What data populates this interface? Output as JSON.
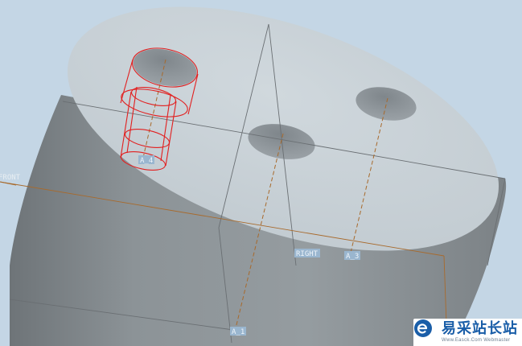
{
  "viewport": {
    "background": "#c4d6e5",
    "body_color": "#8e9599",
    "top_face_color": "#c9d1d6",
    "hole_color": "#8b9297",
    "datum_line_color": "#a86a2c",
    "hidden_edge_color": "#e21f1f",
    "label_color": "#9ab6cf"
  },
  "datum_planes": {
    "front_label": "FRONT",
    "right_label": "RIGHT"
  },
  "datum_axes": {
    "a1_label": "A_1",
    "a3_label": "A_3",
    "a4_label": "A_4"
  },
  "watermark": {
    "logo_icon": "e-letter-logo-icon",
    "logo_color": "#1a5ea8",
    "name": "易采站长站",
    "url": "Www.Easck.Com  Webmaster"
  }
}
